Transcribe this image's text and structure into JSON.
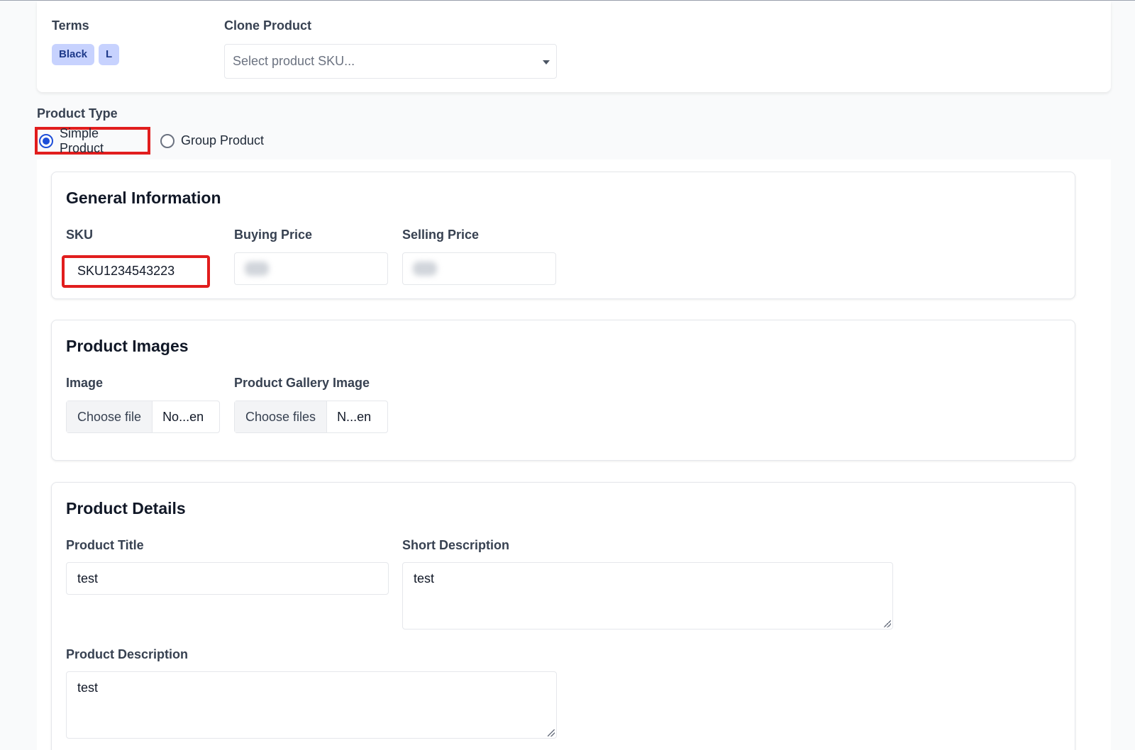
{
  "top": {
    "terms_label": "Terms",
    "terms": [
      "Black",
      "L"
    ],
    "clone_label": "Clone Product",
    "clone_placeholder": "Select product SKU..."
  },
  "product_type": {
    "label": "Product Type",
    "options": [
      {
        "label": "Simple Product",
        "selected": true
      },
      {
        "label": "Group Product",
        "selected": false
      }
    ]
  },
  "general": {
    "title": "General Information",
    "sku_label": "SKU",
    "sku_value": "SKU1234543223",
    "buying_label": "Buying Price",
    "selling_label": "Selling Price"
  },
  "images": {
    "title": "Product Images",
    "image_label": "Image",
    "image_button": "Choose file",
    "image_status": "No...en",
    "gallery_label": "Product Gallery Image",
    "gallery_button": "Choose files",
    "gallery_status": "N...en"
  },
  "details": {
    "title": "Product Details",
    "title_label": "Product Title",
    "title_value": "test",
    "short_label": "Short Description",
    "short_value": "test",
    "desc_label": "Product Description",
    "desc_value": "test"
  },
  "colors": {
    "highlight": "#e11d1d",
    "tag_bg": "#c7d2fe",
    "radio_accent": "#1d4ed8"
  }
}
